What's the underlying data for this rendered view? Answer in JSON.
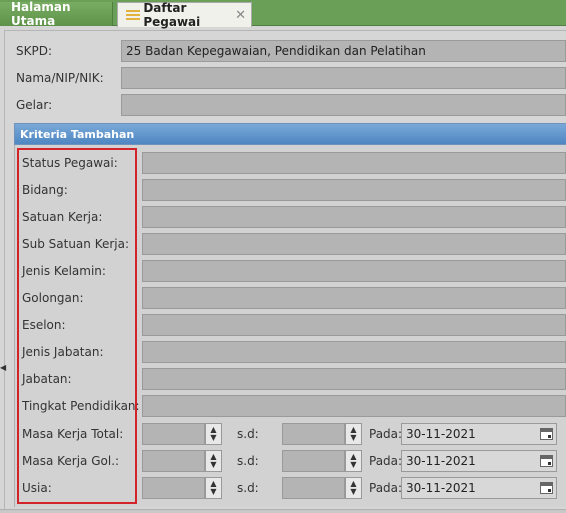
{
  "tabs": [
    {
      "label": "Halaman Utama"
    },
    {
      "label": "Daftar Pegawai",
      "close": "✕"
    }
  ],
  "form": {
    "skpd": {
      "label": "SKPD:",
      "value": "25 Badan Kepegawaian, Pendidikan dan Pelatihan"
    },
    "nama": {
      "label": "Nama/NIP/NIK:",
      "value": ""
    },
    "gelar": {
      "label": "Gelar:",
      "value": ""
    }
  },
  "kriteria": {
    "title": "Kriteria Tambahan",
    "fields": [
      {
        "label": "Status Pegawai:"
      },
      {
        "label": "Bidang:"
      },
      {
        "label": "Satuan Kerja:"
      },
      {
        "label": "Sub Satuan Kerja:"
      },
      {
        "label": "Jenis Kelamin:"
      },
      {
        "label": "Golongan:"
      },
      {
        "label": "Eselon:"
      },
      {
        "label": "Jenis Jabatan:"
      },
      {
        "label": "Jabatan:"
      },
      {
        "label": "Tingkat Pendidikan:"
      }
    ],
    "ranges": [
      {
        "label": "Masa Kerja Total:",
        "sd": "s.d:",
        "pada": "Pada:",
        "date": "30-11-2021"
      },
      {
        "label": "Masa Kerja Gol.:",
        "sd": "s.d:",
        "pada": "Pada:",
        "date": "30-11-2021"
      },
      {
        "label": "Usia:",
        "sd": "s.d:",
        "pada": "Pada:",
        "date": "30-11-2021"
      }
    ]
  },
  "colors": {
    "tab_green": "#6a9f57",
    "header_blue": "#4f86c2",
    "highlight_red": "#d2232a"
  }
}
